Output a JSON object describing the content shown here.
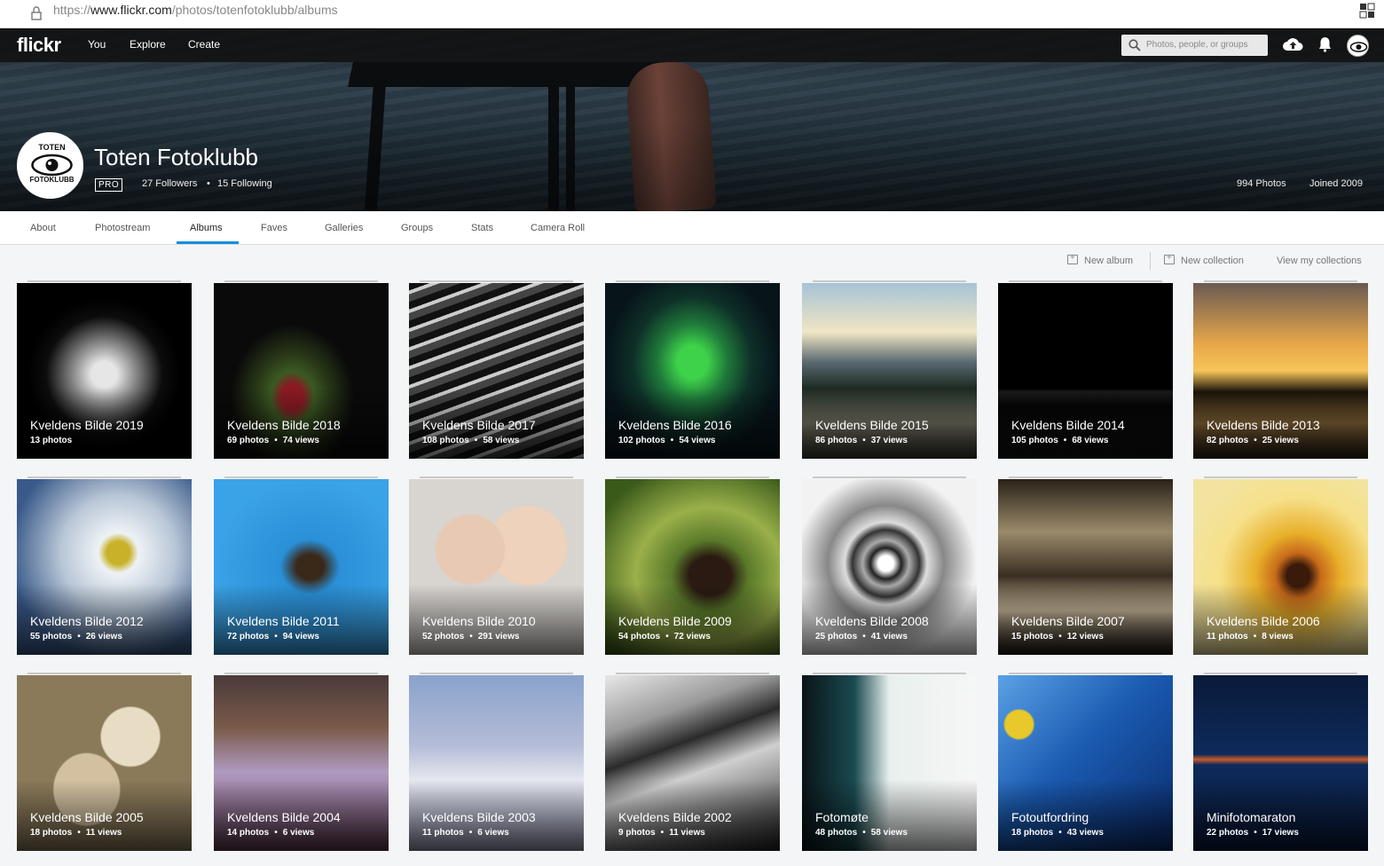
{
  "browser": {
    "url_prefix": "https://",
    "url_host": "www.flickr.com",
    "url_path": "/photos/totenfotoklubb/albums"
  },
  "topnav": {
    "logo": "flickr",
    "links": [
      "You",
      "Explore",
      "Create"
    ],
    "search_placeholder": "Photos, people, or groups"
  },
  "profile": {
    "name": "Toten Fotoklubb",
    "badge": "PRO",
    "followers": "27 Followers",
    "following": "15 Following",
    "photos": "994 Photos",
    "joined": "Joined 2009",
    "avatar_text": "TOTEN FOTOKLUBB"
  },
  "tabs": [
    {
      "label": "About"
    },
    {
      "label": "Photostream"
    },
    {
      "label": "Albums"
    },
    {
      "label": "Faves"
    },
    {
      "label": "Galleries"
    },
    {
      "label": "Groups"
    },
    {
      "label": "Stats"
    },
    {
      "label": "Camera Roll"
    }
  ],
  "actions": {
    "new_album": "New album",
    "new_collection": "New collection",
    "view_collections": "View my collections"
  },
  "albums": [
    {
      "title": "Kveldens Bilde 2019",
      "photos": "13 photos",
      "views": ""
    },
    {
      "title": "Kveldens Bilde 2018",
      "photos": "69 photos",
      "views": "74 views"
    },
    {
      "title": "Kveldens Bilde 2017",
      "photos": "108 photos",
      "views": "58 views"
    },
    {
      "title": "Kveldens Bilde 2016",
      "photos": "102 photos",
      "views": "54 views"
    },
    {
      "title": "Kveldens Bilde 2015",
      "photos": "86 photos",
      "views": "37 views"
    },
    {
      "title": "Kveldens Bilde 2014",
      "photos": "105 photos",
      "views": "68 views"
    },
    {
      "title": "Kveldens Bilde 2013",
      "photos": "82 photos",
      "views": "25 views"
    },
    {
      "title": "Kveldens Bilde 2012",
      "photos": "55 photos",
      "views": "26 views"
    },
    {
      "title": "Kveldens Bilde 2011",
      "photos": "72 photos",
      "views": "94 views"
    },
    {
      "title": "Kveldens Bilde 2010",
      "photos": "52 photos",
      "views": "291 views"
    },
    {
      "title": "Kveldens Bilde 2009",
      "photos": "54 photos",
      "views": "72 views"
    },
    {
      "title": "Kveldens Bilde 2008",
      "photos": "25 photos",
      "views": "41 views"
    },
    {
      "title": "Kveldens Bilde 2007",
      "photos": "15 photos",
      "views": "12 views"
    },
    {
      "title": "Kveldens Bilde 2006",
      "photos": "11 photos",
      "views": "8 views"
    },
    {
      "title": "Kveldens Bilde 2005",
      "photos": "18 photos",
      "views": "11 views"
    },
    {
      "title": "Kveldens Bilde 2004",
      "photos": "14 photos",
      "views": "6 views"
    },
    {
      "title": "Kveldens Bilde 2003",
      "photos": "11 photos",
      "views": "6 views"
    },
    {
      "title": "Kveldens Bilde 2002",
      "photos": "9 photos",
      "views": "11 views"
    },
    {
      "title": "Fotomøte",
      "photos": "48 photos",
      "views": "58 views"
    },
    {
      "title": "Fotoutfordring",
      "photos": "18 photos",
      "views": "43 views"
    },
    {
      "title": "Minifotomaraton",
      "photos": "22 photos",
      "views": "17 views"
    }
  ]
}
